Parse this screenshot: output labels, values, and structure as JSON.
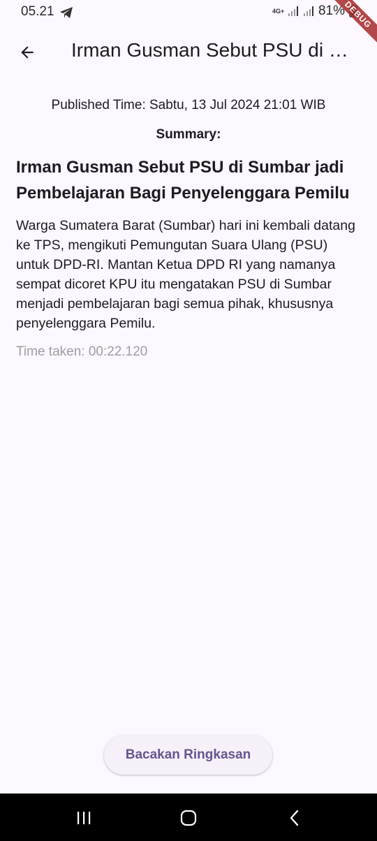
{
  "status_bar": {
    "time": "05.21",
    "network_type": "4G+",
    "battery": "81%",
    "icons": [
      "telegram-icon",
      "signal-icon",
      "signal-icon",
      "battery-icon"
    ]
  },
  "debug_banner": "DEBUG",
  "app_bar": {
    "title": "Irman Gusman Sebut PSU di Sumbar jadi Pembelajaran Bagi Penyelenggara Pemilu",
    "back_icon": "arrow-left-icon"
  },
  "article": {
    "published": "Published Time: Sabtu, 13 Jul 2024 21:01 WIB",
    "summary_label": "Summary:",
    "headline": "Irman Gusman Sebut PSU di Sumbar jadi Pembelajaran Bagi Penyelenggara Pemilu",
    "summary": "Warga Sumatera Barat (Sumbar) hari ini kembali datang ke TPS, mengikuti Pemungutan Suara Ulang (PSU) untuk DPD-RI. Mantan Ketua DPD RI yang namanya sempat dicoret KPU itu mengatakan PSU di Sumbar menjadi pembelajaran bagi semua pihak, khususnya penyelenggara Pemilu.",
    "time_taken": "Time taken: 00:22.120"
  },
  "actions": {
    "read_button": "Bacakan Ringkasan"
  },
  "nav_bar": {
    "icons": [
      "recents-icon",
      "home-icon",
      "back-icon"
    ]
  },
  "colors": {
    "background": "#FDF7FF",
    "accent": "#65558F",
    "muted": "#9E9E9E"
  }
}
